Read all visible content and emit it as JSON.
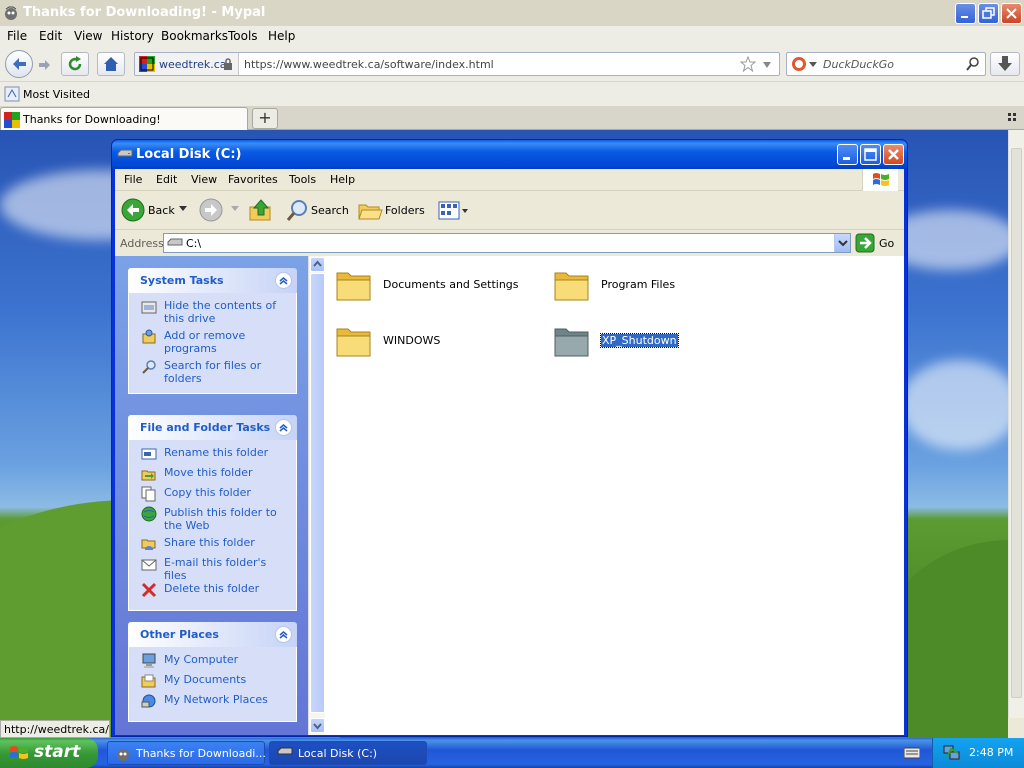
{
  "browser": {
    "title": "Thanks for Downloading! - Mypal",
    "menu": [
      "File",
      "Edit",
      "View",
      "History",
      "Bookmarks",
      "Tools",
      "Help"
    ],
    "menu_underline": [
      "F",
      "E",
      "V",
      "H",
      "B",
      "T",
      "H"
    ],
    "site_identity": "weedtrek.ca",
    "url": "https://www.weedtrek.ca/software/index.html",
    "search_placeholder": "DuckDuckGo",
    "bookmark": "Most Visited",
    "tab_title": "Thanks for Downloading!",
    "new_tab": "+",
    "status_link": "http://weedtrek.ca/so"
  },
  "explorer": {
    "title": "Local Disk (C:)",
    "menu": [
      "File",
      "Edit",
      "View",
      "Favorites",
      "Tools",
      "Help"
    ],
    "toolbar": {
      "back": "Back",
      "search": "Search",
      "folders": "Folders"
    },
    "address_label": "Address",
    "address_value": "C:\\",
    "go": "Go",
    "system_tasks": {
      "title": "System Tasks",
      "items": [
        "Hide the contents of this drive",
        "Add or remove programs",
        "Search for files or folders"
      ]
    },
    "file_folder_tasks": {
      "title": "File and Folder Tasks",
      "items": [
        "Rename this folder",
        "Move this folder",
        "Copy this folder",
        "Publish this folder to the Web",
        "Share this folder",
        "E-mail this folder's files",
        "Delete this folder"
      ]
    },
    "other_places": {
      "title": "Other Places",
      "items": [
        "My Computer",
        "My Documents",
        "My Network Places"
      ]
    },
    "folders": [
      "Documents and Settings",
      "Program Files",
      "WINDOWS",
      "XP_Shutdown"
    ]
  },
  "taskbar": {
    "start": "start",
    "buttons": [
      "Thanks for Downloadi...",
      "Local Disk (C:)"
    ],
    "clock": "2:48 PM"
  },
  "colors": {
    "xp_blue": "#0831d9",
    "task_link": "#215dc6",
    "selection": "#316ac5",
    "start_green": "#379937"
  }
}
